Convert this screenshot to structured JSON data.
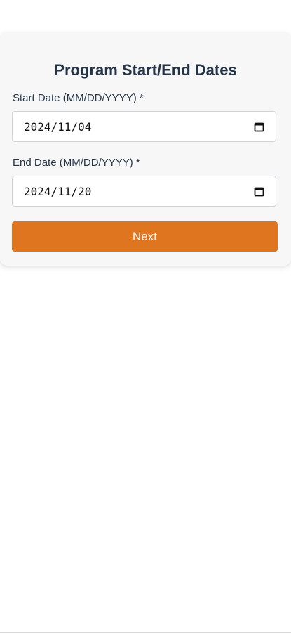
{
  "form": {
    "title": "Program Start/End Dates",
    "start": {
      "label": "Start Date (MM/DD/YYYY) *",
      "value": "2024/11/04",
      "icon": "calendar-icon"
    },
    "end": {
      "label": "End Date (MM/DD/YYYY) *",
      "value": "2024/11/20",
      "icon": "calendar-icon"
    },
    "next_label": "Next"
  },
  "colors": {
    "accent": "#e07520",
    "text": "#253547",
    "card_bg": "#f7f7f7"
  }
}
